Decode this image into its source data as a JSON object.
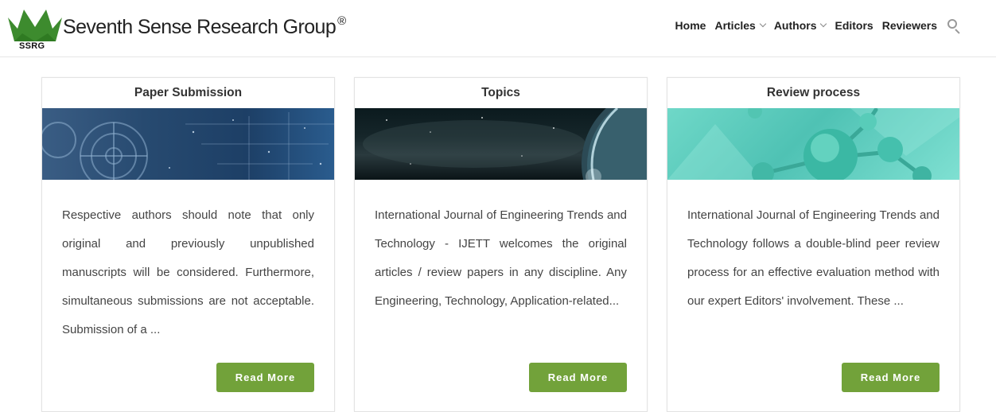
{
  "header": {
    "logo_abbr": "SSRG",
    "brand_name": "Seventh Sense Research Group",
    "brand_mark": "®",
    "logo_icon": "crown-icon",
    "colors": {
      "logo_green": "#3d8b2e",
      "nav_text": "#222222"
    }
  },
  "nav": {
    "items": [
      {
        "label": "Home",
        "has_dropdown": false
      },
      {
        "label": "Articles",
        "has_dropdown": true
      },
      {
        "label": "Authors",
        "has_dropdown": true
      },
      {
        "label": "Editors",
        "has_dropdown": false
      },
      {
        "label": "Reviewers",
        "has_dropdown": false
      }
    ],
    "search_icon": "search-icon"
  },
  "cards": [
    {
      "title": "Paper Submission",
      "image": "gears-circuit-image",
      "text": "Respective authors should note that only original and previously unpublished manuscripts will be considered. Furthermore, simultaneous submissions are not acceptable. Submission of a ...",
      "button": "Read More"
    },
    {
      "title": "Topics",
      "image": "space-planet-image",
      "text": "International Journal of Engineering Trends and Technology - IJETT welcomes the original articles / review papers in any discipline. Any Engineering, Technology, Application-related...",
      "button": "Read More"
    },
    {
      "title": "Review process",
      "image": "molecule-image",
      "text": "International Journal of Engineering Trends and Technology follows a double-blind peer review process for an effective evaluation method with our expert Editors' involvement. These ...",
      "button": "Read More"
    }
  ],
  "colors": {
    "button_green": "#72a23a",
    "card_border": "#e3e3e3"
  }
}
